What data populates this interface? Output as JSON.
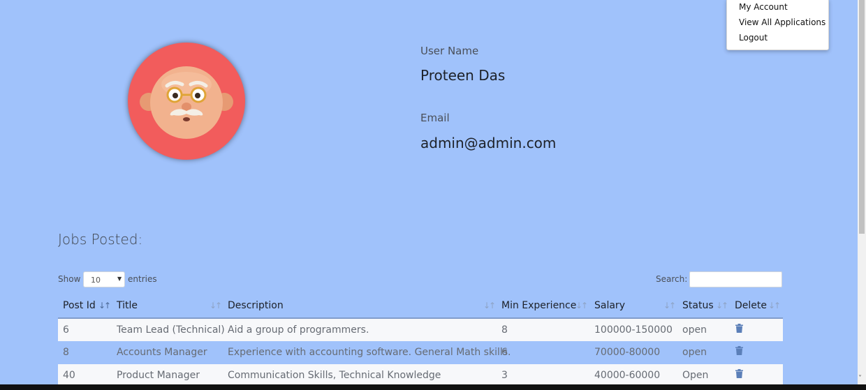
{
  "menu": {
    "items": [
      "My Account",
      "View All Applications",
      "Logout"
    ]
  },
  "profile": {
    "username_label": "User Name",
    "username": "Proteen Das",
    "email_label": "Email",
    "email": "admin@admin.com"
  },
  "jobs": {
    "title": "Jobs Posted:",
    "show_label": "Show",
    "page_size": "10",
    "entries_label": "entries",
    "search_label": "Search:",
    "search_value": "",
    "columns": [
      "Post Id",
      "Title",
      "Description",
      "Min Experience",
      "Salary",
      "Status",
      "Delete"
    ],
    "rows": [
      {
        "post_id": "6",
        "title": "Team Lead (Technical)",
        "description": "Aid a group of programmers.",
        "min_experience": "8",
        "salary": "100000-150000",
        "status": "open"
      },
      {
        "post_id": "8",
        "title": "Accounts Manager",
        "description": "Experience with accounting software. General Math skills.",
        "min_experience": "6",
        "salary": "70000-80000",
        "status": "open"
      },
      {
        "post_id": "40",
        "title": "Product Manager",
        "description": "Communication Skills, Technical Knowledge",
        "min_experience": "3",
        "salary": "40000-60000",
        "status": "Open"
      }
    ]
  },
  "colors": {
    "background": "#a0c2fb",
    "avatar_bg": "#f25c5c",
    "trash_icon": "#5b7fb8"
  },
  "icons": {
    "sort": "sort-arrows-icon",
    "delete": "trash-icon",
    "select": "chevron-down-icon",
    "avatar": "grandpa-emoji-avatar"
  }
}
